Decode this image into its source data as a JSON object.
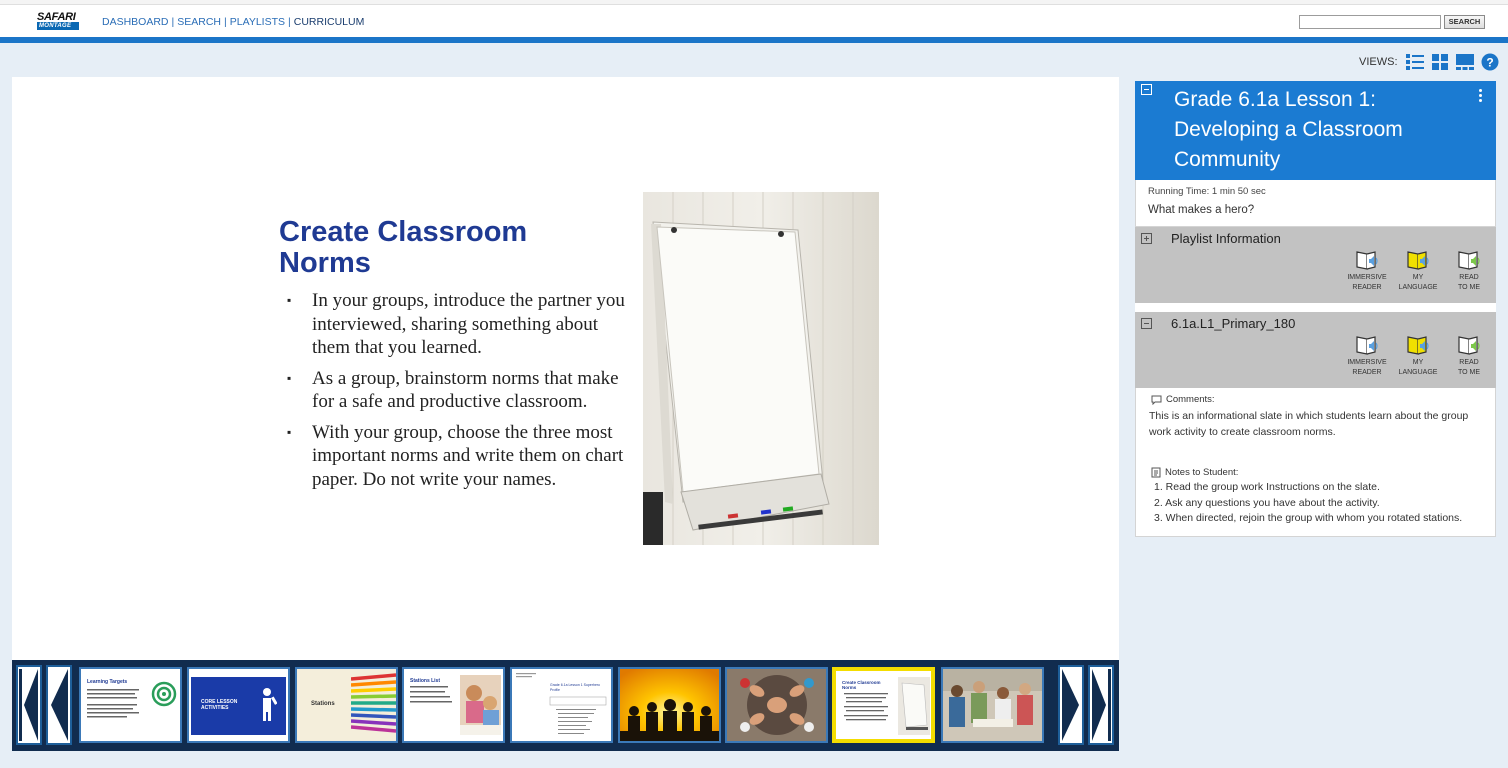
{
  "header": {
    "logo_top": "SAFARI",
    "logo_bottom": "MONTAGE",
    "nav": [
      {
        "label": "DASHBOARD"
      },
      {
        "label": "SEARCH"
      },
      {
        "label": "PLAYLISTS"
      },
      {
        "label": "CURRICULUM"
      }
    ],
    "search_value": "",
    "search_button": "SEARCH"
  },
  "views": {
    "label": "VIEWS:",
    "icons": [
      "list-view-icon",
      "grid-view-icon",
      "filmstrip-view-icon",
      "help-icon"
    ]
  },
  "slide": {
    "title": "Create Classroom Norms",
    "bullet_glyph": "▪",
    "bullets": [
      "In your groups, introduce the partner you interviewed, sharing something about them that you learned.",
      "As a group, brainstorm norms that make for a safe and productive classroom.",
      "With your group, choose the three most important norms and write them on chart paper. Do not write your names."
    ]
  },
  "filmstrip": {
    "active_index": 7,
    "thumbnails": [
      {
        "title": "Learning Targets",
        "kind": "text"
      },
      {
        "title": "CORE LESSON ACTIVITIES",
        "kind": "blue"
      },
      {
        "title": "Stations",
        "kind": "pencils"
      },
      {
        "title": "Stations List",
        "kind": "text-photo"
      },
      {
        "title": "Grade 6.1a Lesson 1 Superhero Profile",
        "kind": "doc"
      },
      {
        "title": "",
        "kind": "heroes"
      },
      {
        "title": "",
        "kind": "hands"
      },
      {
        "title": "Create Classroom Norms",
        "kind": "current"
      },
      {
        "title": "",
        "kind": "group"
      }
    ]
  },
  "lesson": {
    "title": "Grade 6.1a Lesson 1: Developing a Classroom Community",
    "running_time": "Running Time: 1 min 50 sec",
    "question": "What makes a hero?"
  },
  "playlist_info": {
    "title": "Playlist Information"
  },
  "segment": {
    "title": "6.1a.L1_Primary_180"
  },
  "tools": [
    {
      "line1": "IMMERSIVE",
      "line2": "READER",
      "color": "#5aa0e0"
    },
    {
      "line1": "MY",
      "line2": "LANGUAGE",
      "color": "#f0e000"
    },
    {
      "line1": "READ",
      "line2": "TO ME",
      "color": "#7cc84a"
    }
  ],
  "comments": {
    "label": "Comments:",
    "text": "This is an informational slate in which students learn about the group work activity to create classroom norms."
  },
  "notes": {
    "label": "Notes to Student:",
    "items": [
      "1. Read the group work Instructions on the slate.",
      "2. Ask any questions you have about the activity.",
      "3. When directed, rejoin the group with whom you rotated stations."
    ]
  },
  "colors": {
    "accent": "#1b75c8",
    "panel_header": "#1b7bd2",
    "slide_title": "#1f3a93",
    "filmstrip_bg": "#112c4f",
    "active_thumb": "#f4dd00"
  }
}
